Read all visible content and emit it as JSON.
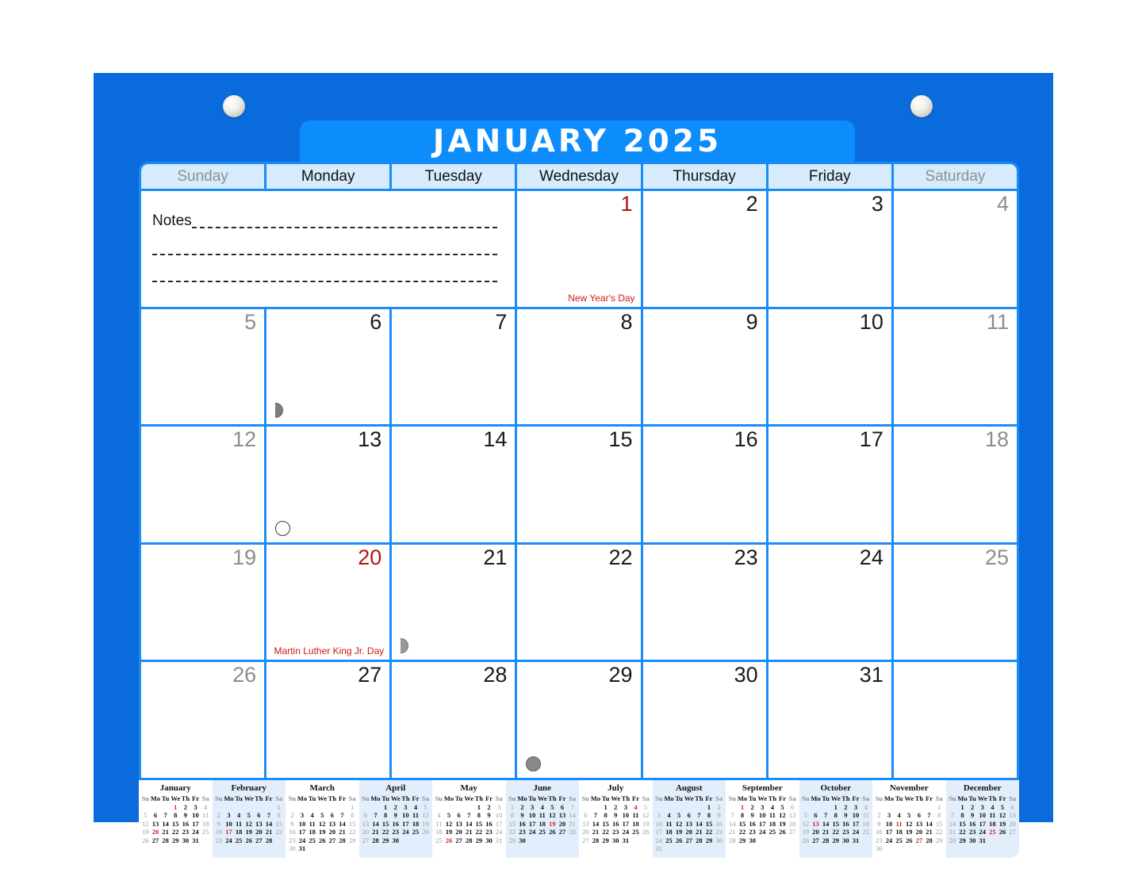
{
  "title": "JANUARY 2025",
  "colors": {
    "board_blue": "#0a6cdc",
    "title_blue": "#0d8cfc",
    "grid_blue": "#1a8cfa",
    "dow_header": "#d6ebfb",
    "holiday_red": "#cc1b14",
    "weekend_gray": "#8d8d8d"
  },
  "weekday_headers": [
    {
      "label": "Sunday",
      "weekend": true
    },
    {
      "label": "Monday",
      "weekend": false
    },
    {
      "label": "Tuesday",
      "weekend": false
    },
    {
      "label": "Wednesday",
      "weekend": false
    },
    {
      "label": "Thursday",
      "weekend": false
    },
    {
      "label": "Friday",
      "weekend": false
    },
    {
      "label": "Saturday",
      "weekend": true
    }
  ],
  "notes": {
    "label": "Notes",
    "line_count": 3
  },
  "weeks": [
    [
      {
        "notes": true
      },
      {
        "day": "1",
        "weekend": false,
        "holiday": true,
        "holiday_label": "New Year's Day"
      },
      {
        "day": "2",
        "weekend": false
      },
      {
        "day": "3",
        "weekend": false
      },
      {
        "day": "4",
        "weekend": true
      }
    ],
    [
      {
        "day": "5",
        "weekend": true
      },
      {
        "day": "6",
        "weekend": false,
        "moon": "first-quarter"
      },
      {
        "day": "7",
        "weekend": false
      },
      {
        "day": "8",
        "weekend": false
      },
      {
        "day": "9",
        "weekend": false
      },
      {
        "day": "10",
        "weekend": false
      },
      {
        "day": "11",
        "weekend": true
      }
    ],
    [
      {
        "day": "12",
        "weekend": true
      },
      {
        "day": "13",
        "weekend": false,
        "moon": "full"
      },
      {
        "day": "14",
        "weekend": false
      },
      {
        "day": "15",
        "weekend": false
      },
      {
        "day": "16",
        "weekend": false
      },
      {
        "day": "17",
        "weekend": false
      },
      {
        "day": "18",
        "weekend": true
      }
    ],
    [
      {
        "day": "19",
        "weekend": true
      },
      {
        "day": "20",
        "weekend": false,
        "holiday": true,
        "holiday_label": "Martin Luther King Jr. Day"
      },
      {
        "day": "21",
        "weekend": false,
        "moon": "last-quarter"
      },
      {
        "day": "22",
        "weekend": false
      },
      {
        "day": "23",
        "weekend": false
      },
      {
        "day": "24",
        "weekend": false
      },
      {
        "day": "25",
        "weekend": true
      }
    ],
    [
      {
        "day": "26",
        "weekend": true
      },
      {
        "day": "27",
        "weekend": false
      },
      {
        "day": "28",
        "weekend": false
      },
      {
        "day": "29",
        "weekend": false,
        "moon": "new"
      },
      {
        "day": "30",
        "weekend": false
      },
      {
        "day": "31",
        "weekend": false
      },
      {
        "day": "",
        "weekend": true
      }
    ]
  ],
  "mini_dow": [
    "Su",
    "Mo",
    "Tu",
    "We",
    "Th",
    "Fr",
    "Sa"
  ],
  "mini_months": [
    {
      "name": "January",
      "start": 3,
      "days": 31,
      "holidays": [
        1,
        20
      ]
    },
    {
      "name": "February",
      "start": 6,
      "days": 28,
      "holidays": [
        17
      ]
    },
    {
      "name": "March",
      "start": 6,
      "days": 31,
      "holidays": []
    },
    {
      "name": "April",
      "start": 2,
      "days": 30,
      "holidays": []
    },
    {
      "name": "May",
      "start": 4,
      "days": 31,
      "holidays": [
        26
      ]
    },
    {
      "name": "June",
      "start": 0,
      "days": 30,
      "holidays": [
        19
      ]
    },
    {
      "name": "July",
      "start": 2,
      "days": 31,
      "holidays": [
        4
      ]
    },
    {
      "name": "August",
      "start": 5,
      "days": 31,
      "holidays": []
    },
    {
      "name": "September",
      "start": 1,
      "days": 30,
      "holidays": [
        1
      ]
    },
    {
      "name": "October",
      "start": 3,
      "days": 31,
      "holidays": [
        13
      ]
    },
    {
      "name": "November",
      "start": 6,
      "days": 30,
      "holidays": [
        11,
        27
      ]
    },
    {
      "name": "December",
      "start": 1,
      "days": 31,
      "holidays": [
        25
      ]
    }
  ]
}
